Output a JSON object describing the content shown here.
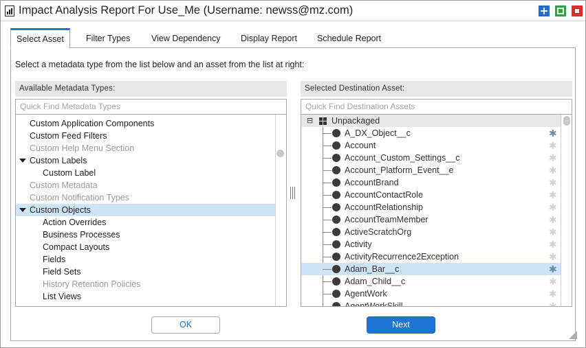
{
  "window": {
    "title": "Impact Analysis Report For Use_Me (Username: newss@mz.com)",
    "icon": "report-icon",
    "controls": [
      {
        "name": "maximize-icon",
        "color": "#1f6fd1",
        "glyph": "+"
      },
      {
        "name": "restore-icon",
        "color": "#2aa33b",
        "glyph": "□"
      },
      {
        "name": "close-icon",
        "color": "#d9302a",
        "glyph": "■"
      }
    ]
  },
  "tabs": [
    {
      "label": "Select Asset",
      "active": true
    },
    {
      "label": "Filter Types",
      "active": false
    },
    {
      "label": "View Dependency",
      "active": false
    },
    {
      "label": "Display Report",
      "active": false
    },
    {
      "label": "Schedule Report",
      "active": false
    }
  ],
  "instruction": "Select a metadata type from the list below and an asset from the list at right:",
  "left_panel": {
    "header": "Available Metadata Types:",
    "search_placeholder": "Quick Find Metadata Types",
    "items": [
      {
        "label": "Custom Application Components",
        "level": 0,
        "dim": false
      },
      {
        "label": "Custom Feed Filters",
        "level": 0,
        "dim": false
      },
      {
        "label": "Custom Help Menu Section",
        "level": 0,
        "dim": true
      },
      {
        "label": "Custom Labels",
        "level": 0,
        "dim": false,
        "expanded": true
      },
      {
        "label": "Custom Label",
        "level": 1,
        "dim": false
      },
      {
        "label": "Custom Metadata",
        "level": 0,
        "dim": true
      },
      {
        "label": "Custom Notification Types",
        "level": 0,
        "dim": true
      },
      {
        "label": "Custom Objects",
        "level": 0,
        "dim": false,
        "expanded": true,
        "selected": true
      },
      {
        "label": "Action Overrides",
        "level": 1,
        "dim": false
      },
      {
        "label": "Business Processes",
        "level": 1,
        "dim": false
      },
      {
        "label": "Compact Layouts",
        "level": 1,
        "dim": false
      },
      {
        "label": "Fields",
        "level": 1,
        "dim": false
      },
      {
        "label": "Field Sets",
        "level": 1,
        "dim": false
      },
      {
        "label": "History Retention Policies",
        "level": 1,
        "dim": true
      },
      {
        "label": "List Views",
        "level": 1,
        "dim": false
      }
    ]
  },
  "right_panel": {
    "header": "Selected Destination Asset:",
    "search_placeholder": "Quick Find Destination Assets",
    "root_label": "Unpackaged",
    "root_toggle": "⊟",
    "items": [
      {
        "label": "A_DX_Object__c",
        "starred": true,
        "selected": false
      },
      {
        "label": "Account",
        "starred": false,
        "selected": false
      },
      {
        "label": "Account_Custom_Settings__c",
        "starred": false,
        "selected": false
      },
      {
        "label": "Account_Platform_Event__e",
        "starred": false,
        "selected": false
      },
      {
        "label": "AccountBrand",
        "starred": false,
        "selected": false
      },
      {
        "label": "AccountContactRole",
        "starred": false,
        "selected": false
      },
      {
        "label": "AccountRelationship",
        "starred": false,
        "selected": false
      },
      {
        "label": "AccountTeamMember",
        "starred": false,
        "selected": false
      },
      {
        "label": "ActiveScratchOrg",
        "starred": false,
        "selected": false
      },
      {
        "label": "Activity",
        "starred": false,
        "selected": false
      },
      {
        "label": "ActivityRecurrence2Exception",
        "starred": false,
        "selected": false
      },
      {
        "label": "Adam_Bar__c",
        "starred": true,
        "selected": true
      },
      {
        "label": "Adam_Child__c",
        "starred": false,
        "selected": false
      },
      {
        "label": "AgentWork",
        "starred": false,
        "selected": false
      },
      {
        "label": "AgentWorkSkill",
        "starred": false,
        "selected": false
      }
    ],
    "star_glyph": "✱"
  },
  "buttons": {
    "ok_label": "OK",
    "next_label": "Next"
  },
  "colors": {
    "accent": "#1f6fd1",
    "selection": "#cfe3f7",
    "dim_text": "#9a9a9a"
  }
}
